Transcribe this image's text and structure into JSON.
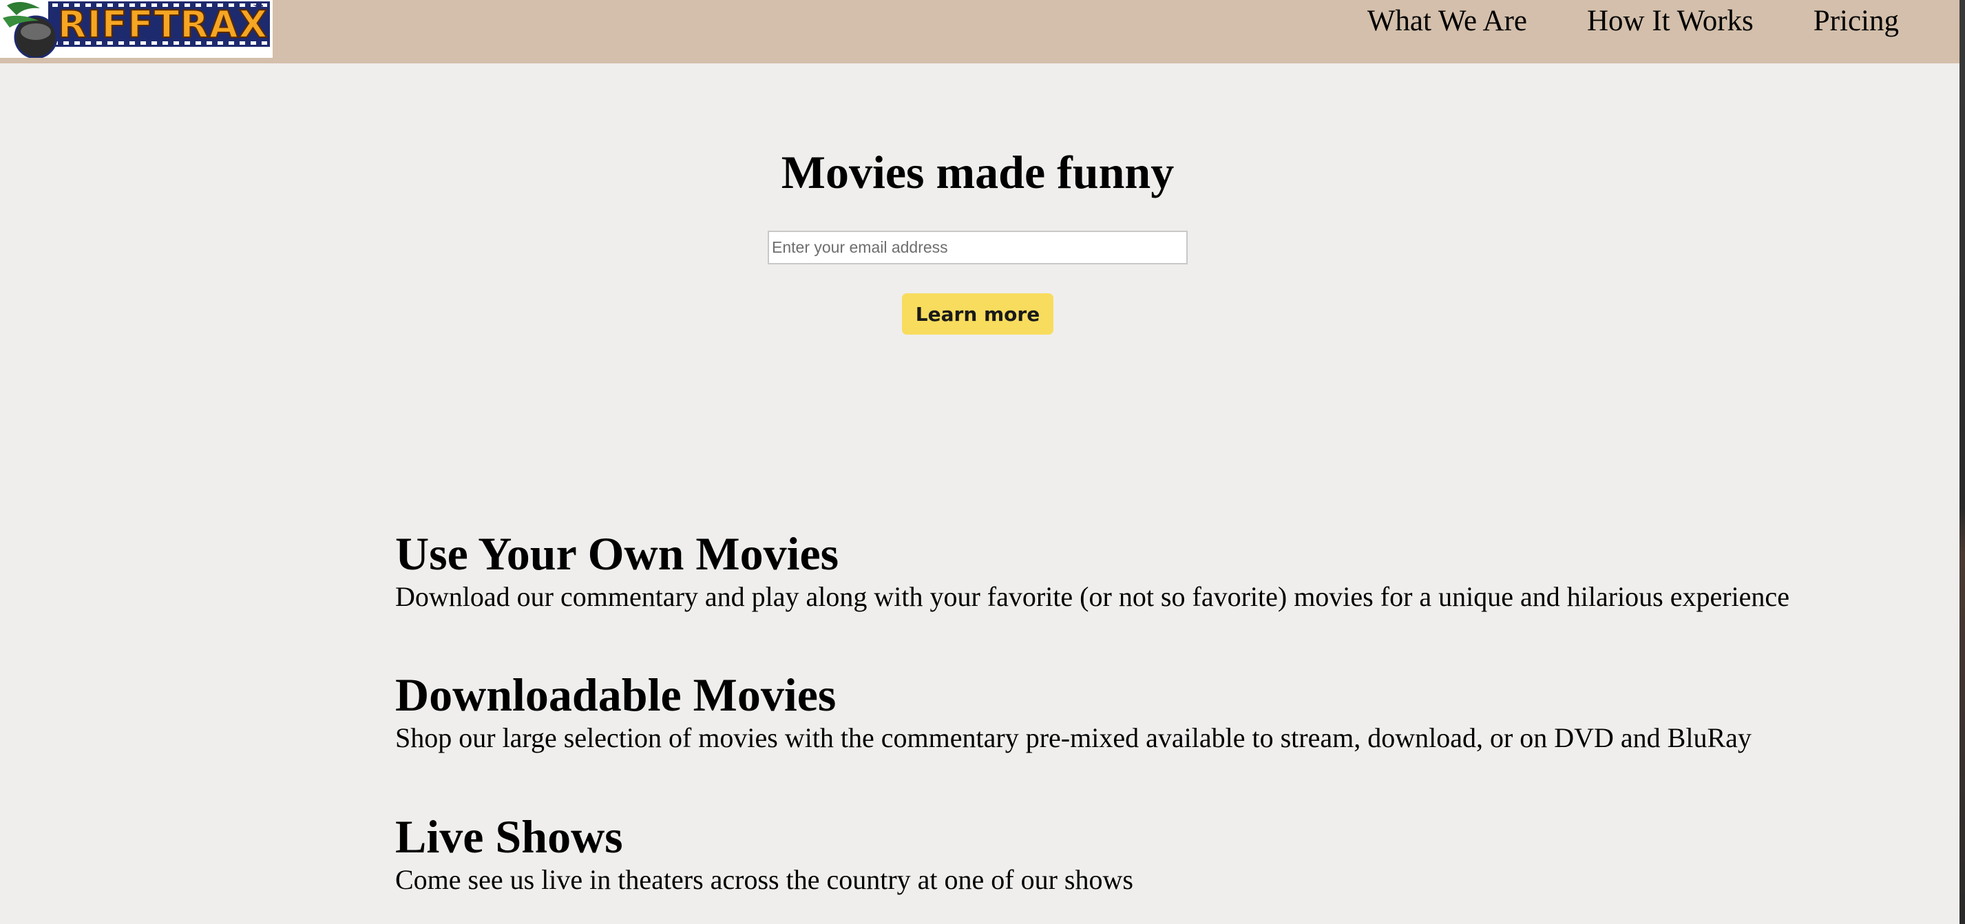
{
  "header": {
    "logo_text": "RIFFTRAX",
    "nav": [
      {
        "label": "What We Are"
      },
      {
        "label": "How It Works"
      },
      {
        "label": "Pricing"
      }
    ]
  },
  "hero": {
    "title": "Movies made funny",
    "email_placeholder": "Enter your email address",
    "cta_label": "Learn more"
  },
  "features": [
    {
      "title": "Use Your Own Movies",
      "description": "Download our commentary and play along with your favorite (or not so favorite) movies for a unique and hilarious experience"
    },
    {
      "title": "Downloadable Movies",
      "description": "Shop our large selection of movies with the commentary pre-mixed available to stream, download, or on DVD and BluRay"
    },
    {
      "title": "Live Shows",
      "description": "Come see us live in theaters across the country at one of our shows"
    }
  ],
  "colors": {
    "header_bg": "#d3bfab",
    "page_bg": "#efeeec",
    "button_bg": "#f8dc5e",
    "logo_letters": "#f6a623"
  }
}
